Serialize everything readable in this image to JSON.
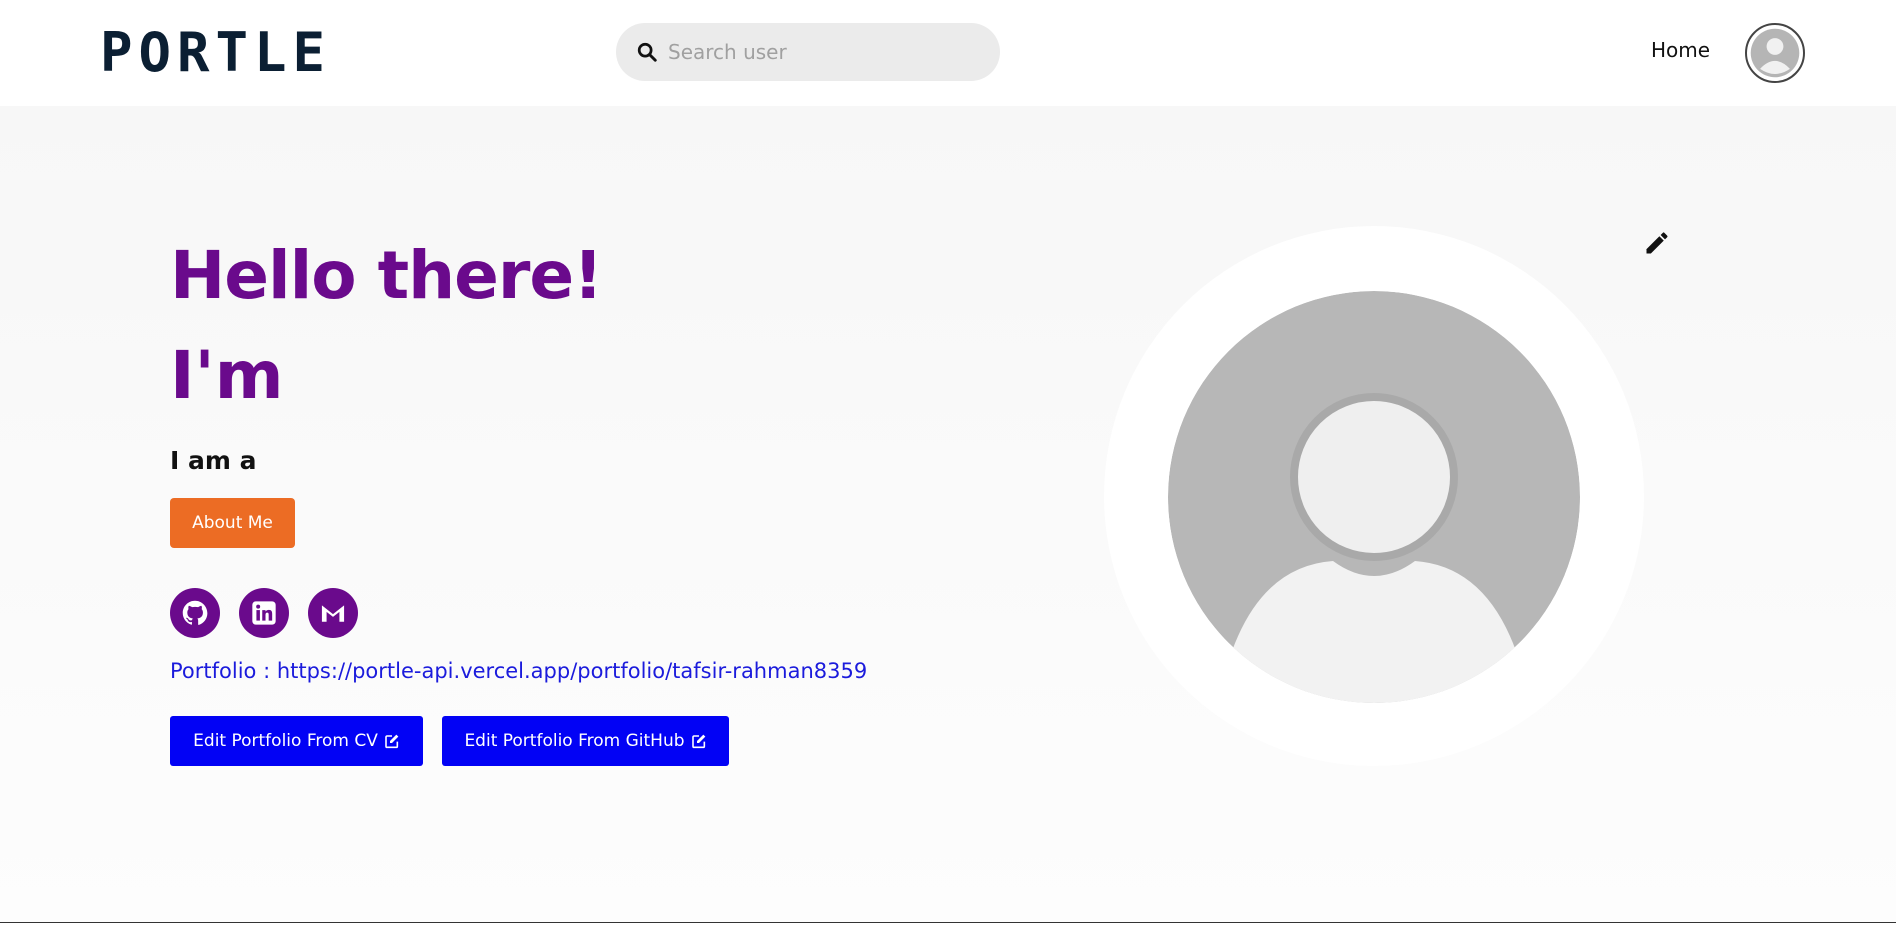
{
  "navbar": {
    "logo_text": "PORTLE",
    "search_placeholder": "Search user",
    "home_label": "Home"
  },
  "hero": {
    "greeting": "Hello there!",
    "name_line": "I'm",
    "role_line": "I am a",
    "about_button": "About Me",
    "socials": [
      "github-icon",
      "linkedin-icon",
      "gmail-icon"
    ],
    "portfolio_label": "Portfolio :",
    "portfolio_url": "https://portle-api.vercel.app/portfolio/tafsir-rahman8359",
    "edit_cv_button": "Edit Portfolio From CV",
    "edit_github_button": "Edit Portfolio From GitHub"
  },
  "colors": {
    "brand": "#0b1f33",
    "accent_purple": "#6a0a8c",
    "about_orange": "#ec6c24",
    "edit_blue": "#0202f5",
    "link_blue": "#1b1bdc"
  }
}
